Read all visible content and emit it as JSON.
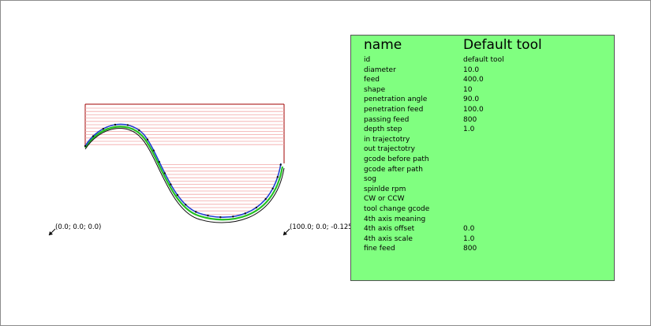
{
  "canvas": {
    "origin_labels": [
      {
        "text": "(0.0; 0.0; 0.0)"
      },
      {
        "text": "(100.0; 0.0; -0.125)"
      }
    ]
  },
  "tool_panel": {
    "header_name": "name",
    "header_value": "Default tool",
    "rows": [
      {
        "key": "id",
        "value": "default tool"
      },
      {
        "key": "diameter",
        "value": "10.0"
      },
      {
        "key": "feed",
        "value": "400.0"
      },
      {
        "key": "shape",
        "value": "10"
      },
      {
        "key": "penetration angle",
        "value": "90.0"
      },
      {
        "key": "penetration feed",
        "value": "100.0"
      },
      {
        "key": "passing feed",
        "value": "800"
      },
      {
        "key": "depth step",
        "value": "1.0"
      },
      {
        "key": "in trajectotry",
        "value": ""
      },
      {
        "key": "out trajectotry",
        "value": ""
      },
      {
        "key": "gcode before path",
        "value": ""
      },
      {
        "key": "gcode after path",
        "value": ""
      },
      {
        "key": "sog",
        "value": ""
      },
      {
        "key": "spinlde rpm",
        "value": ""
      },
      {
        "key": "CW or CCW",
        "value": ""
      },
      {
        "key": "tool change gcode",
        "value": ""
      },
      {
        "key": "4th axis meaning",
        "value": ""
      },
      {
        "key": "4th axis offset",
        "value": "0.0"
      },
      {
        "key": "4th axis scale",
        "value": "1.0"
      },
      {
        "key": "fine feed",
        "value": "800"
      }
    ],
    "color": "#80ff80"
  },
  "colors": {
    "hatch": "#f2a8a8",
    "outline": "#a00000",
    "path_blue": "#1f3fd0",
    "path_green": "#22c022",
    "path_black": "#111111"
  }
}
